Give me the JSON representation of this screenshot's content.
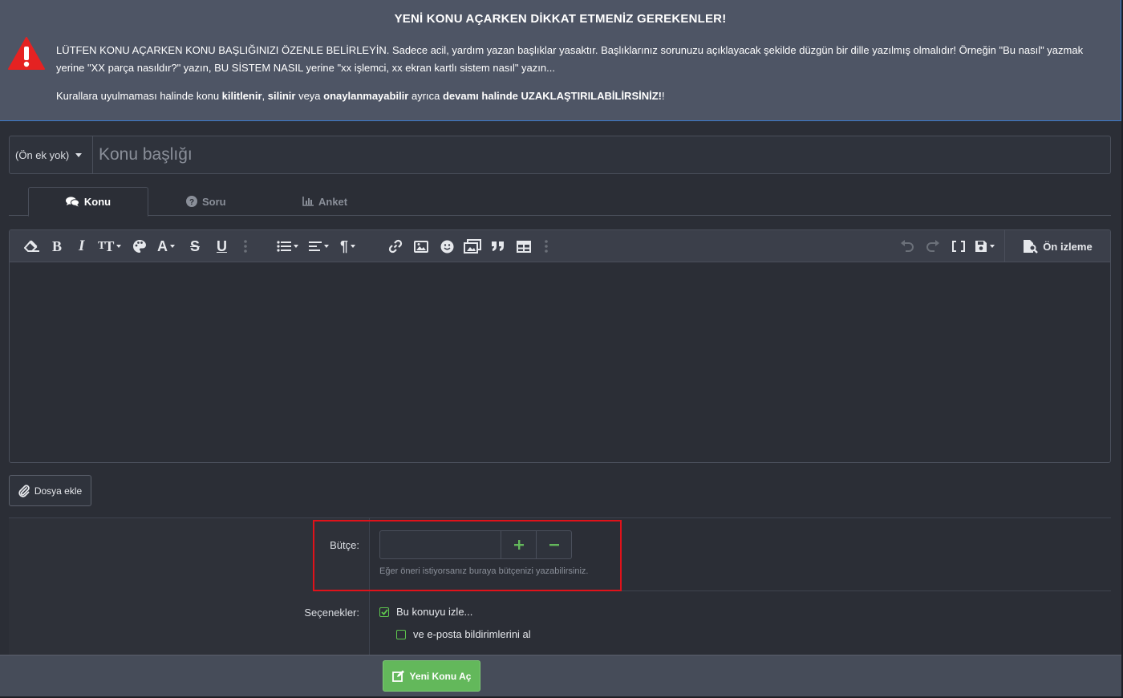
{
  "notice": {
    "title": "YENİ KONU AÇARKEN DİKKAT ETMENİZ GEREKENLER!",
    "p1": "LÜTFEN KONU AÇARKEN KONU BAŞLIĞINIZI ÖZENLE BELİRLEYİN. Sadece acil, yardım yazan başlıklar yasaktır. Başlıklarınız sorunuzu açıklayacak şekilde düzgün bir dille yazılmış olmalıdır! Örneğin \"Bu nasıl\" yazmak yerine \"XX parça nasıldır?\" yazın, BU SİSTEM NASIL yerine \"xx işlemci, xx ekran kartlı sistem nasıl\" yazın...",
    "p2_a": "Kurallara uyulmaması halinde konu ",
    "p2_b": "kilitlenir",
    "p2_c": ", ",
    "p2_d": "silinir",
    "p2_e": " veya ",
    "p2_f": "onaylanmayabilir",
    "p2_g": " ayrıca ",
    "p2_h": "devamı halinde UZAKLAŞTIRILABİLİRSİNİZ!",
    "p2_i": "!"
  },
  "title_row": {
    "prefix": "(Ön ek yok)",
    "placeholder": "Konu başlığı"
  },
  "tabs": [
    {
      "label": "Konu",
      "icon": "comments-icon",
      "active": true
    },
    {
      "label": "Soru",
      "icon": "question-circle-icon",
      "active": false
    },
    {
      "label": "Anket",
      "icon": "bar-chart-icon",
      "active": false
    }
  ],
  "toolbar": {
    "preview_label": "Ön izleme",
    "buttons": [
      "eraser-icon",
      "bold-icon",
      "italic-icon",
      "text-size-icon",
      "palette-icon",
      "font-icon",
      "strikethrough-icon",
      "underline-icon",
      "more-icon",
      "list-icon",
      "align-icon",
      "paragraph-icon",
      "link-icon",
      "image-icon",
      "smiley-icon",
      "media-icon",
      "quote-icon",
      "table-icon",
      "more-icon",
      "undo-icon",
      "redo-icon",
      "bbcode-icon",
      "save-draft-icon"
    ]
  },
  "attach": {
    "label": "Dosya ekle"
  },
  "budget": {
    "label": "Bütçe:",
    "value": "",
    "hint": "Eğer öneri istiyorsanız buraya bütçenizi yazabilirsiniz."
  },
  "options": {
    "label": "Seçenekler:",
    "watch": {
      "label": "Bu konuyu izle...",
      "checked": true
    },
    "email": {
      "label": "ve e-posta bildirimlerini al",
      "checked": false
    }
  },
  "submit": {
    "label": "Yeni Konu Aç"
  },
  "colors": {
    "accent_green": "#63b85b",
    "highlight_red": "#e0121a",
    "notice_bg": "#4e5565"
  }
}
